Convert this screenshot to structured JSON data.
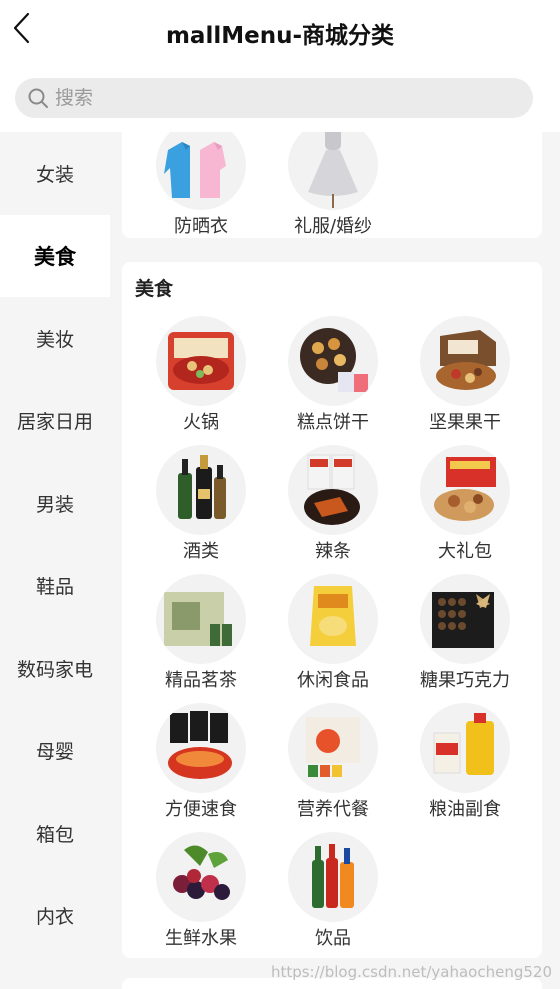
{
  "header": {
    "title": "mallMenu-商城分类"
  },
  "search": {
    "placeholder": "搜索"
  },
  "sidebar": {
    "items": [
      {
        "label": "女装",
        "active": false
      },
      {
        "label": "美食",
        "active": true
      },
      {
        "label": "美妆",
        "active": false
      },
      {
        "label": "居家日用",
        "active": false
      },
      {
        "label": "男装",
        "active": false
      },
      {
        "label": "鞋品",
        "active": false
      },
      {
        "label": "数码家电",
        "active": false
      },
      {
        "label": "母婴",
        "active": false
      },
      {
        "label": "箱包",
        "active": false
      },
      {
        "label": "内衣",
        "active": false
      }
    ]
  },
  "sections": {
    "prev": {
      "items": [
        {
          "label": "防晒衣",
          "icon": "sun-protection-jacket-icon"
        },
        {
          "label": "礼服/婚纱",
          "icon": "wedding-dress-icon"
        }
      ]
    },
    "food": {
      "title": "美食",
      "items": [
        {
          "label": "火锅",
          "icon": "hotpot-icon"
        },
        {
          "label": "糕点饼干",
          "icon": "cookies-icon"
        },
        {
          "label": "坚果果干",
          "icon": "nuts-icon"
        },
        {
          "label": "酒类",
          "icon": "liquor-icon"
        },
        {
          "label": "辣条",
          "icon": "spicy-strip-icon"
        },
        {
          "label": "大礼包",
          "icon": "gift-pack-icon"
        },
        {
          "label": "精品茗茶",
          "icon": "tea-icon"
        },
        {
          "label": "休闲食品",
          "icon": "snacks-icon"
        },
        {
          "label": "糖果巧克力",
          "icon": "chocolate-icon"
        },
        {
          "label": "方便速食",
          "icon": "instant-noodles-icon"
        },
        {
          "label": "营养代餐",
          "icon": "meal-replacement-icon"
        },
        {
          "label": "粮油副食",
          "icon": "grain-oil-icon"
        },
        {
          "label": "生鲜水果",
          "icon": "fresh-fruit-icon"
        },
        {
          "label": "饮品",
          "icon": "drinks-icon"
        }
      ]
    }
  },
  "watermark": "https://blog.csdn.net/yahaocheng520",
  "colors": {
    "background": "#f5f5f5",
    "card": "#ffffff",
    "search": "#ebebeb",
    "text": "#333333"
  }
}
